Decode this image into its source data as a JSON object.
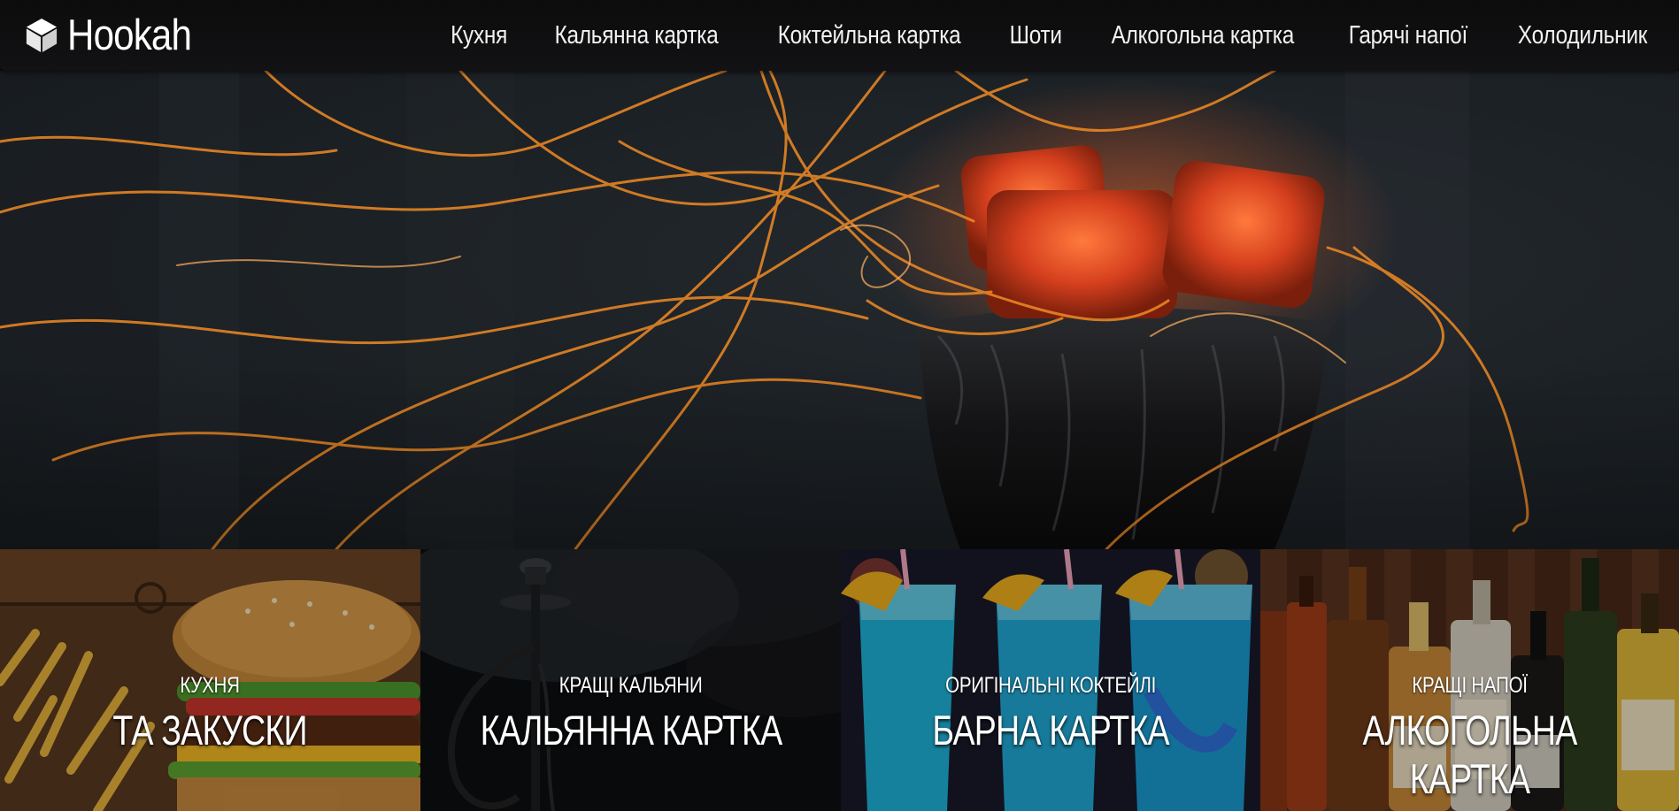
{
  "brand": {
    "name": "Hookah",
    "icon": "cube-icon"
  },
  "nav": {
    "items": [
      {
        "label": "Кухня"
      },
      {
        "label": "Кальянна картка"
      },
      {
        "label": "Коктейльна картка"
      },
      {
        "label": "Шоти"
      },
      {
        "label": "Алкогольна картка"
      },
      {
        "label": "Гарячі напої"
      },
      {
        "label": "Холодильник"
      }
    ]
  },
  "hero": {
    "image": "hookah-bowl-with-glowing-coals-and-sparks"
  },
  "tiles": [
    {
      "subtitle": "Кухня",
      "title": "та закуски",
      "image": "burger-and-fries"
    },
    {
      "subtitle": "Кращі кальяни",
      "title": "Кальянна картка",
      "image": "hookah-in-smoke"
    },
    {
      "subtitle": "Оригінальні коктейлі",
      "title": "Барна картка",
      "image": "blue-cocktails"
    },
    {
      "subtitle": "Кращі напої",
      "title": "Алкогольна картка",
      "image": "liquor-bottles"
    }
  ],
  "colors": {
    "header": "#0f0f10",
    "spark": "#f08a24",
    "coal": "#e5512a",
    "cocktail": "#1fb3d8"
  }
}
